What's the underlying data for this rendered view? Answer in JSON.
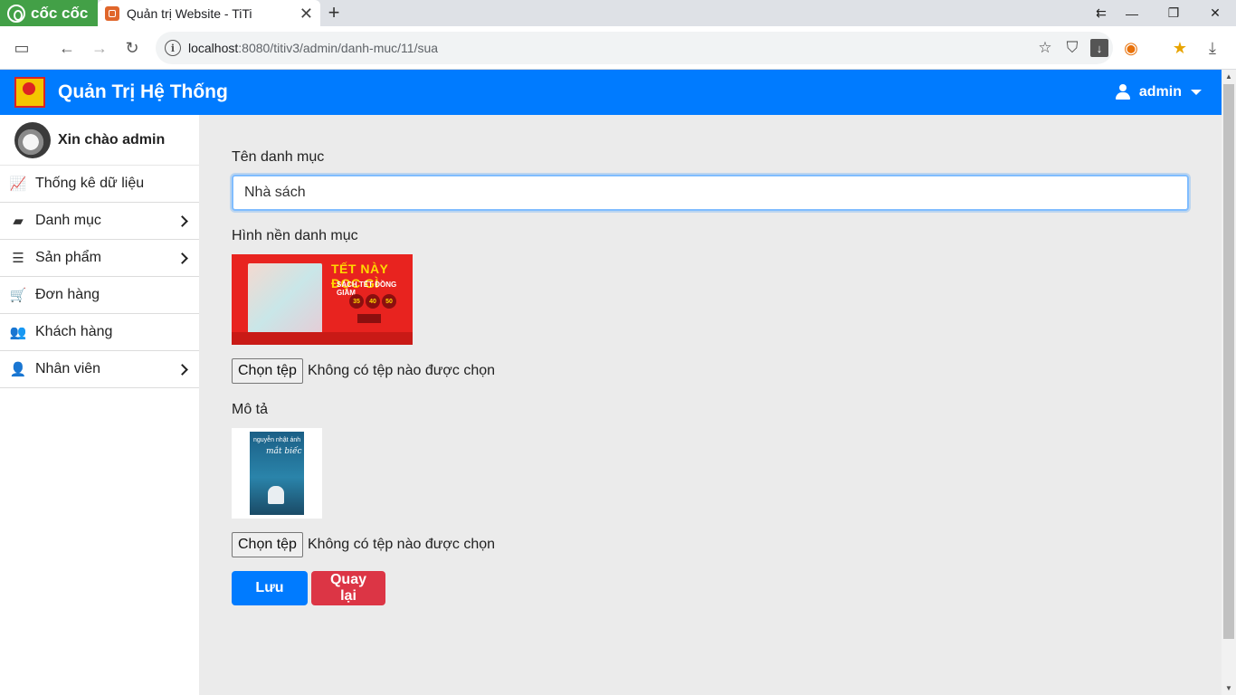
{
  "browser": {
    "brand": "cốc cốc",
    "tab_title": "Quản trị Website - TiTi",
    "tab_close": "✕",
    "new_tab": "+",
    "url_host": "localhost",
    "url_rest": ":8080/titiv3/admin/danh-muc/11/sua"
  },
  "navbar": {
    "title": "Quản Trị Hệ Thống",
    "user": "admin"
  },
  "sidebar": {
    "greeting": "Xin chào admin",
    "items": [
      {
        "label": "Thống kê dữ liệu",
        "icon": "chart-line-icon",
        "has_arrow": false
      },
      {
        "label": "Danh mục",
        "icon": "folder-open-icon",
        "has_arrow": true
      },
      {
        "label": "Sản phẩm",
        "icon": "database-icon",
        "has_arrow": true
      },
      {
        "label": "Đơn hàng",
        "icon": "cart-icon",
        "has_arrow": false
      },
      {
        "label": "Khách hàng",
        "icon": "users-icon",
        "has_arrow": false
      },
      {
        "label": "Nhân viên",
        "icon": "user-lock-icon",
        "has_arrow": true
      }
    ]
  },
  "form": {
    "name_label": "Tên danh mục",
    "name_value": "Nhà sách",
    "bg_label": "Hình nền danh mục",
    "banner_title": "TẾT NÀY ĐỌC GÌ",
    "banner_sub": "SÁCH TẾT ĐỒNG GIẢM",
    "banner_discounts": [
      "35",
      "40",
      "50"
    ],
    "cover_author": "nguyễn nhật ánh",
    "cover_title": "mắt biếc",
    "file_button": "Chọn tệp",
    "file_status": "Không có tệp nào được chọn",
    "desc_label": "Mô tả",
    "save_button": "Lưu",
    "back_button": "Quay lại"
  },
  "colors": {
    "primary": "#007bff",
    "danger": "#dc3545",
    "coccoc_green": "#43a047"
  }
}
